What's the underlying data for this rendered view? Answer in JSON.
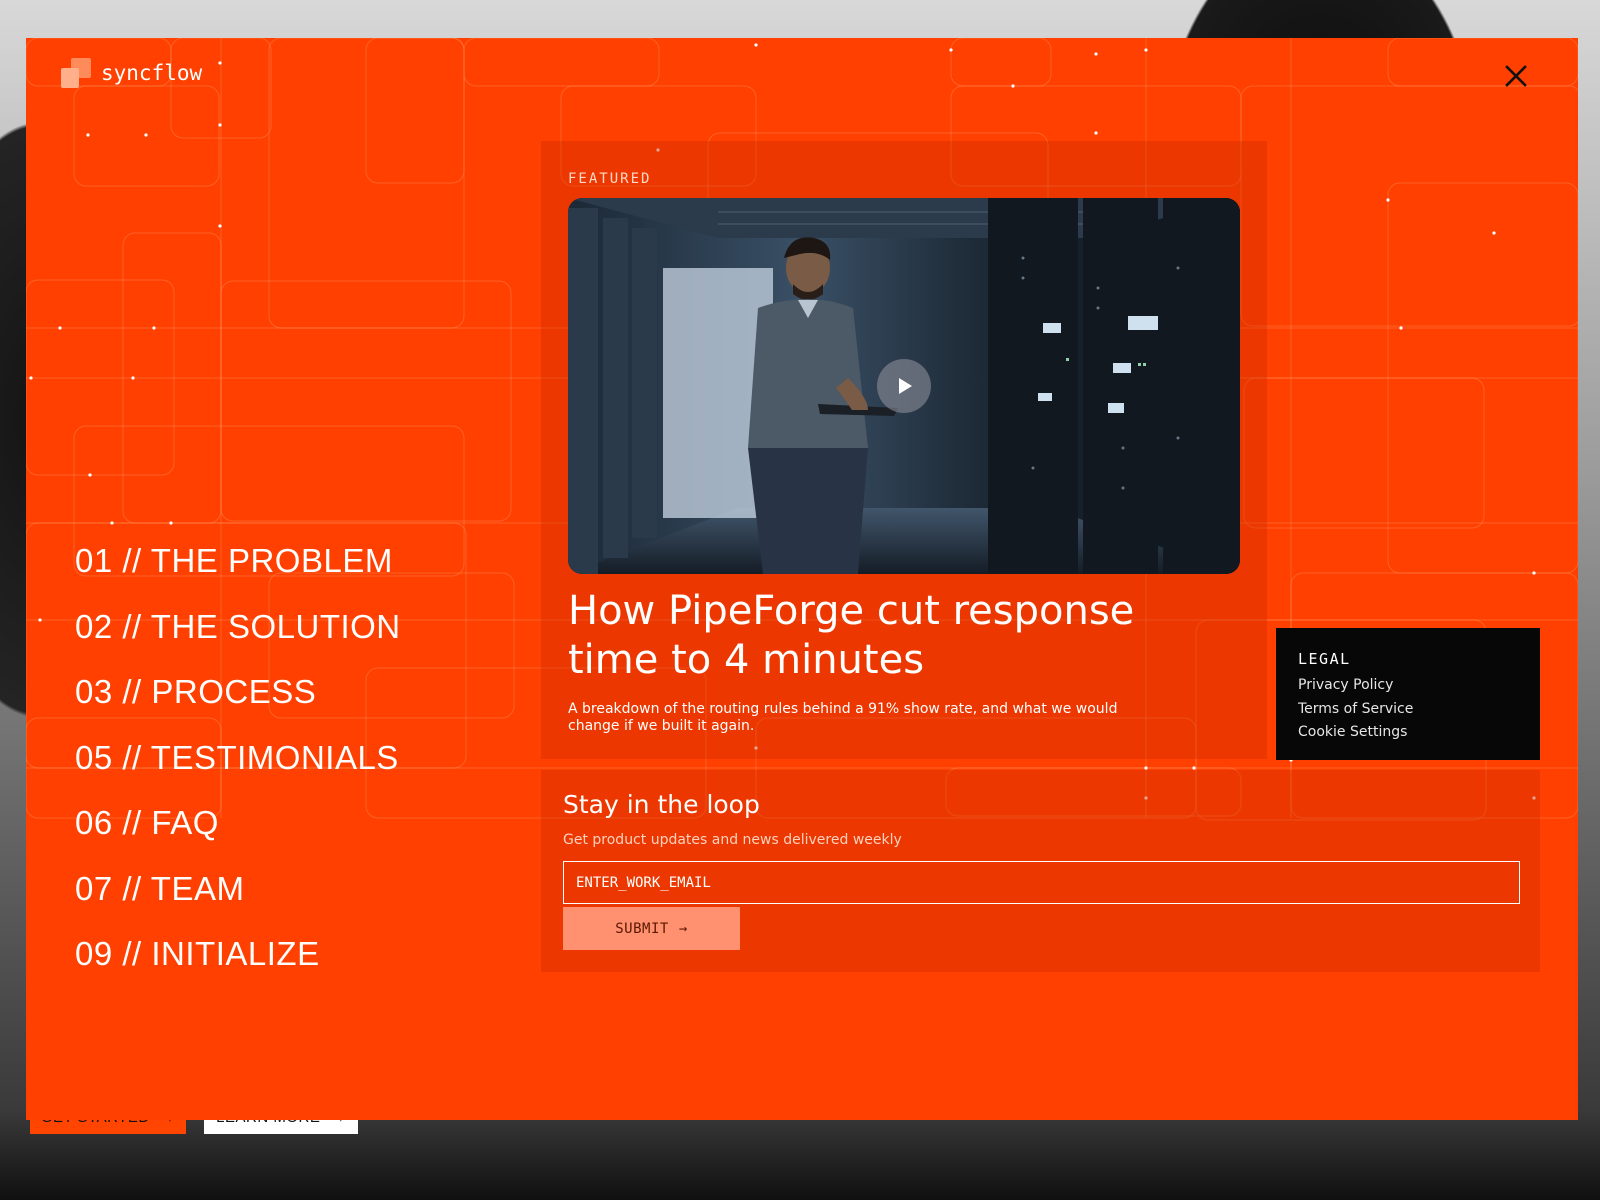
{
  "brand": {
    "name": "syncflow"
  },
  "background_page": {
    "primary_button": "GET STARTED",
    "secondary_button": "LEARN MORE",
    "arrow": "→"
  },
  "menu": {
    "close_icon": "close-icon",
    "nav_items": [
      "01 // THE PROBLEM",
      "02 // THE SOLUTION",
      "03 // PROCESS",
      "05 // TESTIMONIALS",
      "06 // FAQ",
      "07 // TEAM",
      "09 // INITIALIZE"
    ]
  },
  "featured": {
    "label": "FEATURED",
    "title": "How PipeForge cut response time to 4 minutes",
    "description": "A breakdown of the routing rules behind a 91% show rate, and what we would change if we built it again.",
    "video_icon": "play-icon"
  },
  "legal": {
    "title": "LEGAL",
    "links": [
      "Privacy Policy",
      "Terms of Service",
      "Cookie Settings"
    ]
  },
  "newsletter": {
    "title": "Stay in the loop",
    "subtitle": "Get product updates and news delivered weekly",
    "email_placeholder": "ENTER_WORK_EMAIL",
    "submit_label": "SUBMIT",
    "submit_arrow": "→"
  },
  "colors": {
    "accent": "#ff4000",
    "panel": "#070707",
    "submit_bg": "#ff9070"
  }
}
